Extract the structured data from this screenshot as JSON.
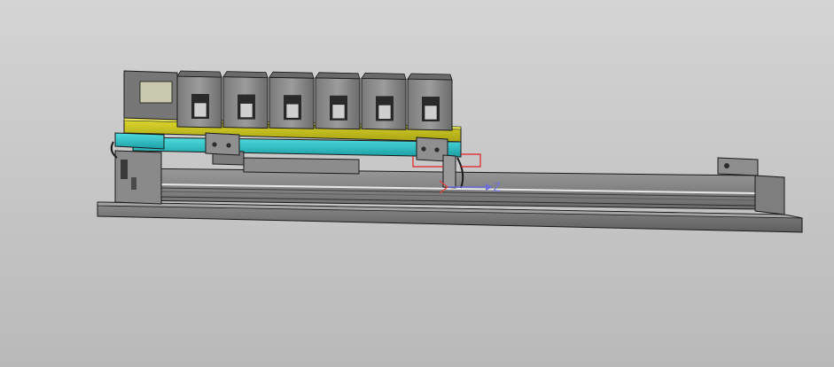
{
  "viewport": {
    "background_top": "#d4d4d4",
    "background_bottom": "#b9b9b9"
  },
  "model": {
    "part_colors": {
      "housing": "#8a8a8a",
      "housing_dark": "#5a5a5a",
      "plate_yellow": "#c7c21a",
      "plate_cyan": "#2ec4c9",
      "outline": "#1a1a1a",
      "selection": "#e02020"
    },
    "module_count": 6
  },
  "axis_triad": {
    "z_label": "Z",
    "color": "#6f6fd8"
  }
}
